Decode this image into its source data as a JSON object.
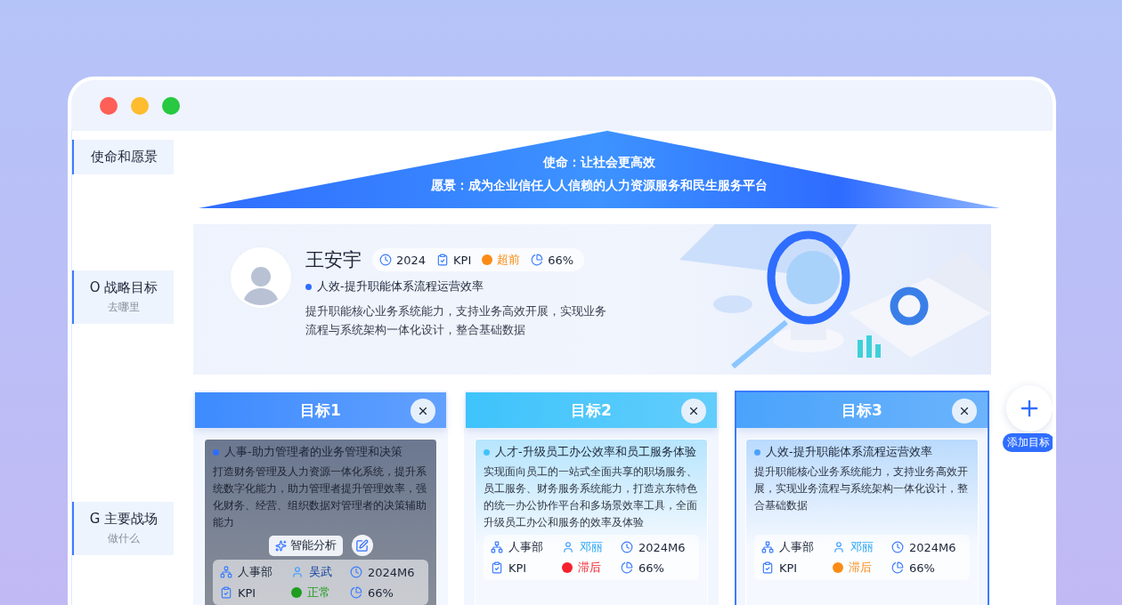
{
  "sidebar": {
    "items": [
      {
        "title": "使命和愿景",
        "selected": false
      },
      {
        "title": "O 战略目标",
        "subtitle": "去哪里",
        "selected": false
      },
      {
        "title": "G 主要战场",
        "subtitle": "做什么",
        "selected": false
      }
    ]
  },
  "banner": {
    "mission": "使命：让社会更高效",
    "vision": "愿景：成为企业信任人人信赖的人力资源服务和民生服务平台"
  },
  "profile": {
    "name": "王安宇",
    "chips": [
      {
        "kind": "year",
        "text": "2024"
      },
      {
        "kind": "type",
        "text": "KPI"
      },
      {
        "kind": "status",
        "text": "超前",
        "color": "#fa8c16"
      },
      {
        "kind": "progress",
        "text": "66%"
      }
    ],
    "goal": "人效-提升职能体系流程运营效率",
    "description": "提升职能核心业务系统能力，支持业务高效开展，实现业务流程与系统架构一体化设计，整合基础数据"
  },
  "cards": [
    {
      "title": "目标1",
      "color": "#3d8bff",
      "selected": false,
      "hovered": true,
      "goal": "人事-助力管理者的业务管理和决策",
      "description": "打造财务管理及人力资源一体化系统，提升系统数字化能力，助力管理者提升管理效率，强化财务、经营、组织数据对管理者的决策辅助能力",
      "department": "人事部",
      "owner": "吴武",
      "date": "2024M6",
      "type": "KPI",
      "status": {
        "text": "正常",
        "color": "#1f9d1f"
      },
      "progress": "66%"
    },
    {
      "title": "目标2",
      "color": "#3ec3fb",
      "selected": false,
      "hovered": false,
      "goal": "人才-升级员工办公效率和员工服务体验",
      "description": "实现面向员工的一站式全面共享的职场服务、员工服务、财务服务系统能力，打造京东特色的统一办公协作平台和多场景效率工具，全面升级员工办公和服务的效率及体验",
      "department": "人事部",
      "owner": "邓丽",
      "date": "2024M6",
      "type": "KPI",
      "status": {
        "text": "滞后",
        "color": "#f5222d"
      },
      "progress": "66%"
    },
    {
      "title": "目标3",
      "color": "#4aa3fb",
      "selected": true,
      "hovered": false,
      "goal": "人效-提升职能体系流程运营效率",
      "description": "提升职能核心业务系统能力，支持业务高效开展，实现业务流程与系统架构一体化设计，整合基础数据",
      "department": "人事部",
      "owner": "邓丽",
      "date": "2024M6",
      "type": "KPI",
      "status": {
        "text": "滞后",
        "color": "#fa8c16"
      },
      "progress": "66%"
    }
  ],
  "hover_menu": {
    "label": "智能分析"
  },
  "add_button": {
    "label": "添加目标"
  }
}
